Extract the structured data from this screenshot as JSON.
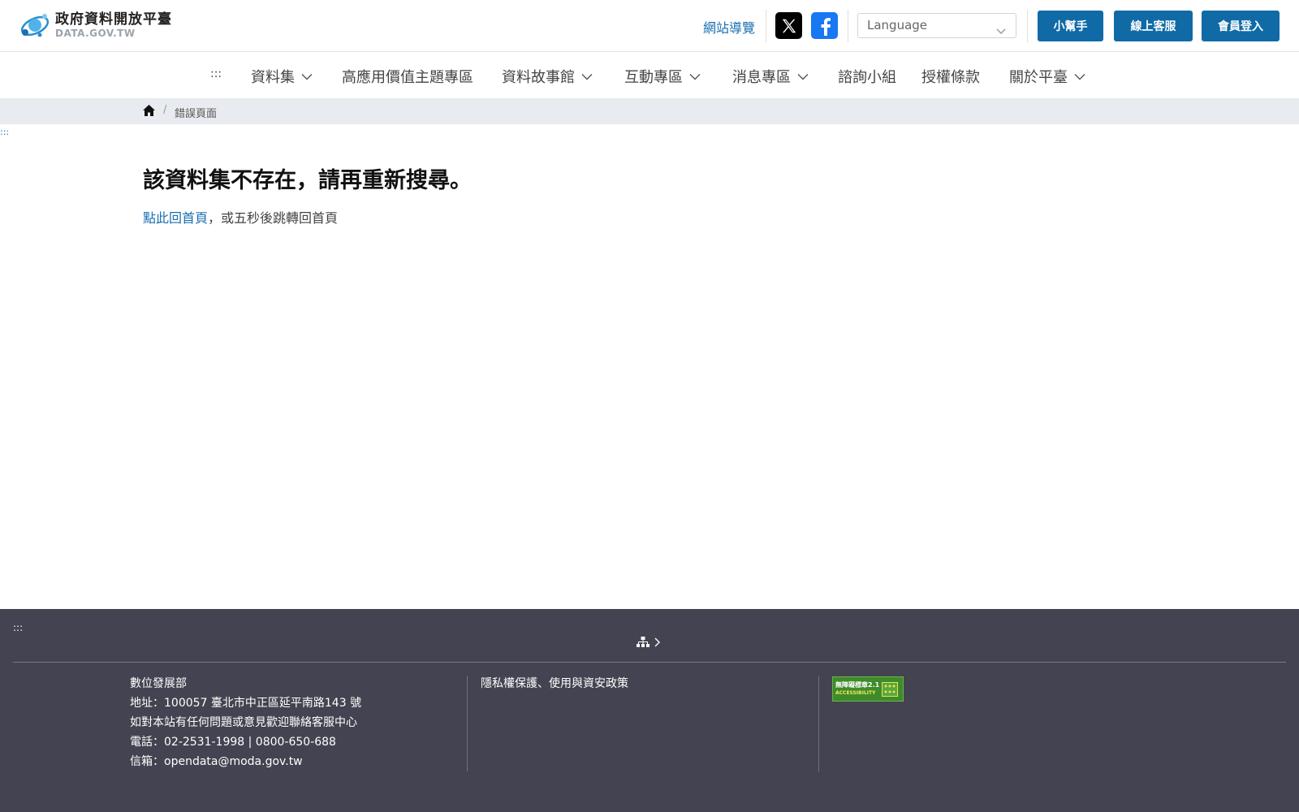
{
  "header": {
    "logo_cn": "政府資料開放平臺",
    "logo_en": "DATA.GOV.TW",
    "sitemap_label": "網站導覽",
    "language_placeholder": "Language",
    "buttons": {
      "helper": "小幫手",
      "service": "線上客服",
      "login": "會員登入"
    }
  },
  "nav": {
    "skip": ":::",
    "items": [
      {
        "label": "資料集",
        "dropdown": true
      },
      {
        "label": "高應用價值主題專區",
        "dropdown": false
      },
      {
        "label": "資料故事館",
        "dropdown": true
      },
      {
        "label": "互動專區",
        "dropdown": true
      },
      {
        "label": "消息專區",
        "dropdown": true
      },
      {
        "label": "諮詢小組",
        "dropdown": false
      },
      {
        "label": "授權條款",
        "dropdown": false
      },
      {
        "label": "關於平臺",
        "dropdown": true
      }
    ]
  },
  "breadcrumb": {
    "separator": "/",
    "current": "錯誤頁面"
  },
  "main": {
    "skip": ":::",
    "title": "該資料集不存在，請再重新搜尋。",
    "home_link": "點此回首頁",
    "message_rest": "，或五秒後跳轉回首頁"
  },
  "footer": {
    "skip": ":::",
    "org": "數位發展部",
    "address": "地址：100057 臺北市中正區延平南路143 號",
    "contact_note": "如對本站有任何問題或意見歡迎聯絡客服中心",
    "phone": "電話：02-2531-1998 | 0800-650-688",
    "email": "信箱：opendata@moda.gov.tw",
    "policy_link": "隱私權保護、使用與資安政策",
    "a11y_badge": "無障礙標章2.1",
    "a11y_badge_en": "ACCESSIBILITY"
  },
  "colors": {
    "primary": "#0f6aa6",
    "link": "#1a6fb0",
    "footer_bg": "#434351",
    "breadcrumb_bg": "#e8ecf0"
  }
}
